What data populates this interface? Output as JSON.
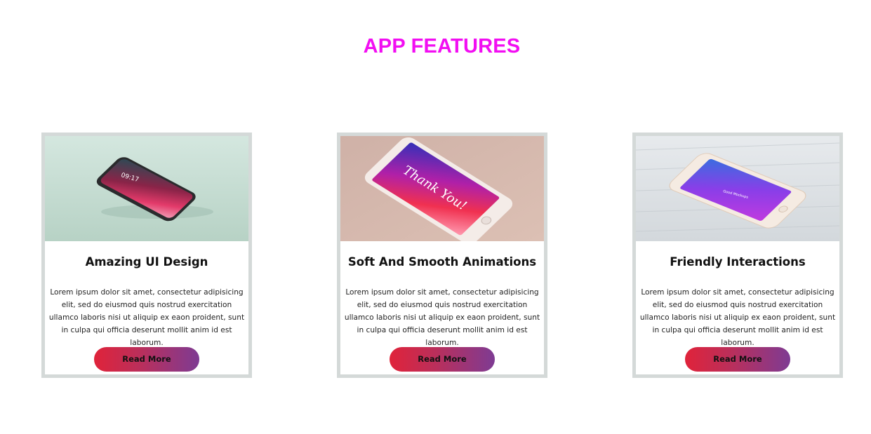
{
  "section": {
    "title": "APP FEATURES"
  },
  "cards": [
    {
      "image_alt": "Dark phone mockup on mint background",
      "title": "Amazing UI Design",
      "text": "Lorem ipsum dolor sit amet, consectetur adipisicing elit, sed do eiusmod quis nostrud exercitation ullamco laboris nisi ut aliquip ex eaon proident, sunt in culpa qui officia deserunt mollit anim id est laborum.",
      "button_label": "Read More",
      "phone_time": "09:17",
      "accent_color": "#c2dacd"
    },
    {
      "image_alt": "Rose gold phone mockup with Thank You screen",
      "title": "Soft And Smooth Animations",
      "text": "Lorem ipsum dolor sit amet, consectetur adipisicing elit, sed do eiusmod quis nostrud exercitation ullamco laboris nisi ut aliquip ex eaon proident, sunt in culpa qui officia deserunt mollit anim id est laborum.",
      "button_label": "Read More",
      "screen_text": "Thank You!",
      "accent_color": "#d7b6aa"
    },
    {
      "image_alt": "Gold phone mockup on white wood",
      "title": "Friendly Interactions",
      "text": "Lorem ipsum dolor sit amet, consectetur adipisicing elit, sed do eiusmod quis nostrud exercitation ullamco laboris nisi ut aliquip ex eaon proident, sunt in culpa qui officia deserunt mollit anim id est laborum.",
      "button_label": "Read More",
      "screen_text": "Good Mockups",
      "accent_color": "#dde1e4"
    }
  ],
  "colors": {
    "title": "#f20ef2",
    "card_border": "#d4d9d8",
    "button_gradient_start": "#e0233a",
    "button_gradient_end": "#7e3b93"
  }
}
